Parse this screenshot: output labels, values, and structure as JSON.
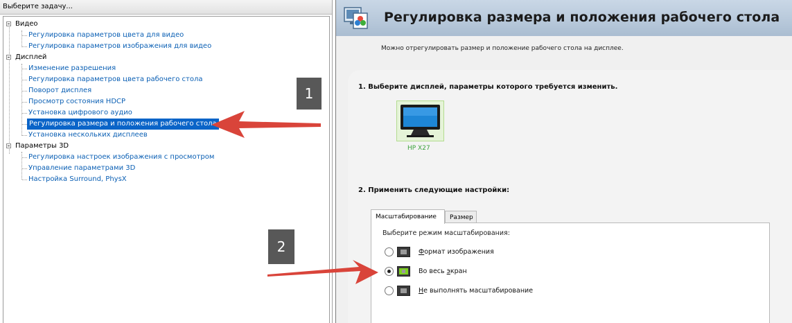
{
  "left_panel": {
    "header": "Выберите задачу...",
    "tree": [
      {
        "label": "Видео",
        "type": "category",
        "children": [
          {
            "label": "Регулировка параметров цвета для видео"
          },
          {
            "label": "Регулировка параметров изображения для видео"
          }
        ]
      },
      {
        "label": "Дисплей",
        "type": "category",
        "children": [
          {
            "label": "Изменение разрешения"
          },
          {
            "label": "Регулировка параметров цвета рабочего стола"
          },
          {
            "label": "Поворот дисплея"
          },
          {
            "label": "Просмотр состояния HDCP"
          },
          {
            "label": "Установка цифрового аудио"
          },
          {
            "label": "Регулировка размера и положения рабочего стола",
            "selected": true
          },
          {
            "label": "Установка нескольких дисплеев"
          }
        ]
      },
      {
        "label": "Параметры 3D",
        "type": "category",
        "children": [
          {
            "label": "Регулировка настроек изображения с просмотром"
          },
          {
            "label": "Управление параметрами 3D"
          },
          {
            "label": "Настройка Surround, PhysX"
          }
        ]
      }
    ]
  },
  "main": {
    "title": "Регулировка размера и положения рабочего стола",
    "subtitle": "Можно отрегулировать размер и положение рабочего стола на дисплее.",
    "section1": "1. Выберите дисплей, параметры которого требуется изменить.",
    "display_name": "HP X27",
    "section2": "2. Применить следующие настройки:",
    "tabs": [
      {
        "label": "Масштабирование",
        "active": true
      },
      {
        "label": "Размер",
        "active": false
      }
    ],
    "scaling_prompt": "Выберите режим масштабирования:",
    "modes": [
      {
        "pre": "",
        "u": "Ф",
        "post": "ормат изображения",
        "checked": false
      },
      {
        "pre": "Во весь ",
        "u": "э",
        "post": "кран",
        "checked": true
      },
      {
        "pre": "",
        "u": "Н",
        "post": "е выполнять масштабирование",
        "checked": false
      }
    ]
  },
  "annotations": {
    "badge1": "1",
    "badge2": "2",
    "arrow_color": "#d9443a"
  },
  "colors": {
    "link": "#0a5fb4",
    "selection": "#0a64c8",
    "display_label": "#3aa13a"
  }
}
